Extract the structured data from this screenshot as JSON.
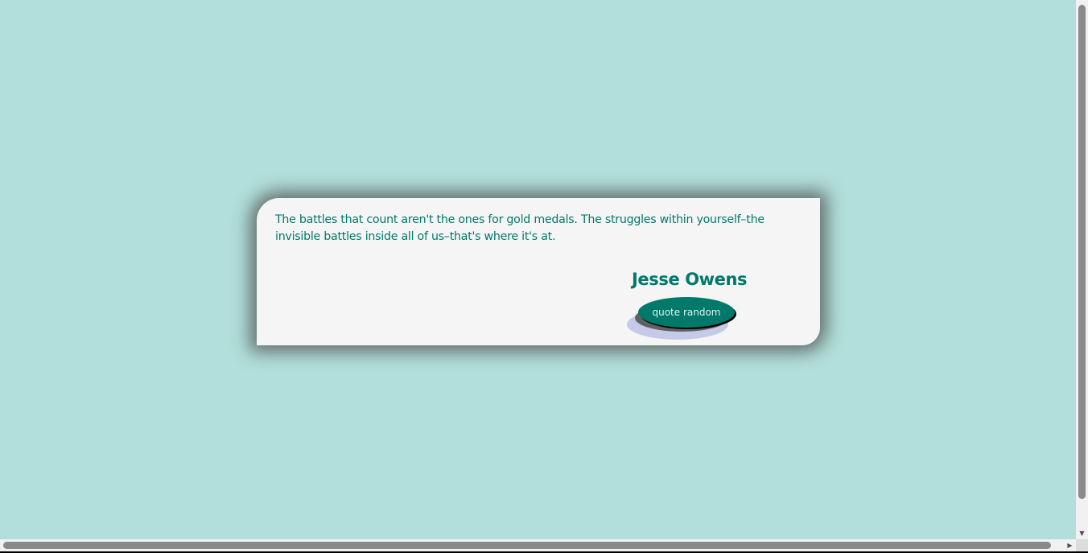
{
  "quote": {
    "text": "The battles that count aren't the ones for gold medals. The struggles within yourself–the invisible battles inside all of us–that's where it's at.",
    "author": "Jesse Owens"
  },
  "button": {
    "label": "quote random"
  },
  "colors": {
    "page_background": "#b2dfdb",
    "card_background": "#f5f5f5",
    "accent": "#00796b",
    "button_text": "#e0f2f1"
  },
  "icons": {
    "scroll_up": "scroll-up-arrow-icon",
    "scroll_down": "scroll-down-arrow-icon",
    "scroll_right": "scroll-right-arrow-icon"
  }
}
